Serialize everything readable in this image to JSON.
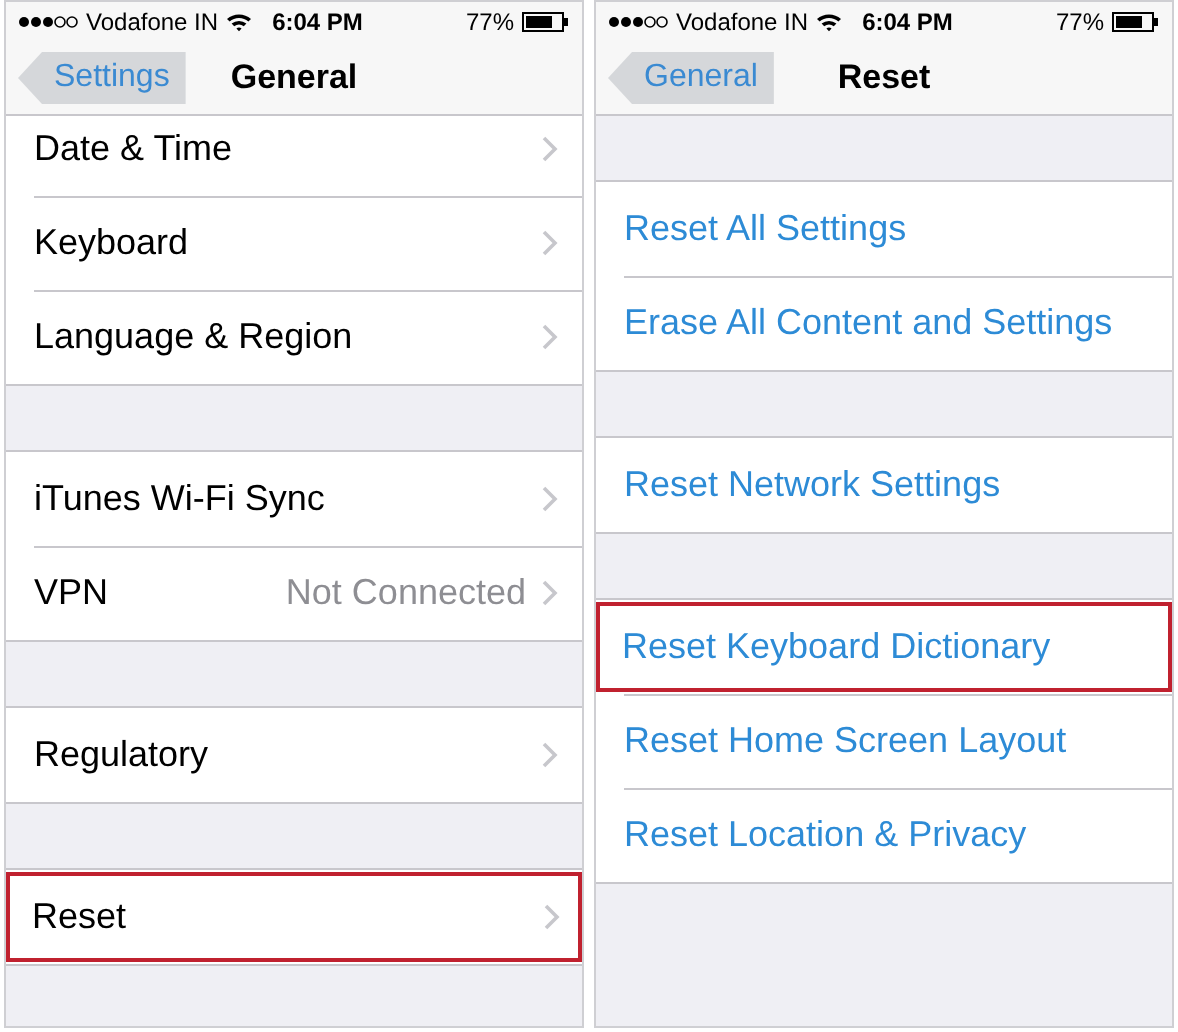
{
  "panels": [
    {
      "status_bar": {
        "carrier": "Vodafone IN",
        "time": "6:04 PM",
        "battery": "77%"
      },
      "nav": {
        "back": "Settings",
        "title": "General"
      },
      "groups": [
        {
          "gap_before": false,
          "rows": [
            {
              "kind": "nav",
              "label": "Date & Time",
              "highlighted": false
            },
            {
              "kind": "nav",
              "label": "Keyboard",
              "highlighted": false
            },
            {
              "kind": "nav",
              "label": "Language & Region",
              "highlighted": false
            }
          ]
        },
        {
          "gap_before": true,
          "rows": [
            {
              "kind": "nav",
              "label": "iTunes Wi-Fi Sync",
              "highlighted": false
            },
            {
              "kind": "nav",
              "label": "VPN",
              "value": "Not Connected",
              "highlighted": false
            }
          ]
        },
        {
          "gap_before": true,
          "rows": [
            {
              "kind": "nav",
              "label": "Regulatory",
              "highlighted": false
            }
          ]
        },
        {
          "gap_before": true,
          "rows": [
            {
              "kind": "nav",
              "label": "Reset",
              "highlighted": true
            }
          ]
        }
      ]
    },
    {
      "status_bar": {
        "carrier": "Vodafone IN",
        "time": "6:04 PM",
        "battery": "77%"
      },
      "nav": {
        "back": "General",
        "title": "Reset"
      },
      "groups": [
        {
          "gap_before": true,
          "rows": [
            {
              "kind": "action",
              "label": "Reset All Settings",
              "highlighted": false
            },
            {
              "kind": "action",
              "label": "Erase All Content and Settings",
              "highlighted": false
            }
          ]
        },
        {
          "gap_before": true,
          "rows": [
            {
              "kind": "action",
              "label": "Reset Network Settings",
              "highlighted": false
            }
          ]
        },
        {
          "gap_before": true,
          "rows": [
            {
              "kind": "action",
              "label": "Reset Keyboard Dictionary",
              "highlighted": true
            },
            {
              "kind": "action",
              "label": "Reset Home Screen Layout",
              "highlighted": false
            },
            {
              "kind": "action",
              "label": "Reset Location & Privacy",
              "highlighted": false
            }
          ]
        }
      ]
    }
  ]
}
